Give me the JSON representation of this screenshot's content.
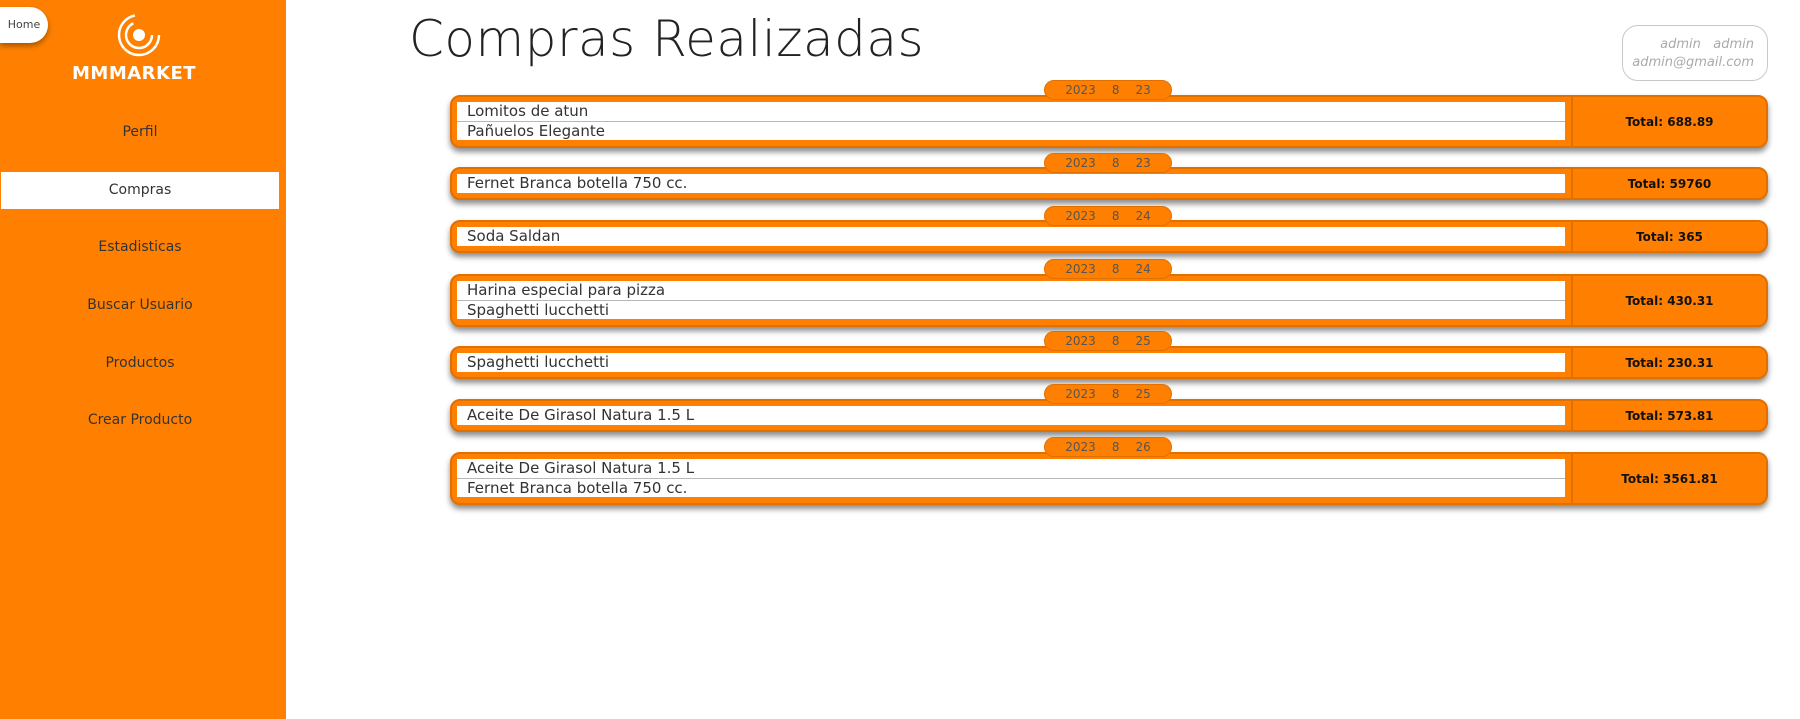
{
  "home": {
    "label": "Home"
  },
  "brand": {
    "logo_text": "MMMARKET"
  },
  "sidebar": {
    "items": [
      {
        "label": "Perfil"
      },
      {
        "label": "Compras"
      },
      {
        "label": "Estadisticas"
      },
      {
        "label": "Buscar Usuario"
      },
      {
        "label": "Productos"
      },
      {
        "label": "Crear Producto"
      }
    ],
    "active": "Compras"
  },
  "page": {
    "title": "Compras Realizadas"
  },
  "user": {
    "first_name": "admin",
    "last_name": "admin",
    "email": "admin@gmail.com"
  },
  "purchases": [
    {
      "year": "2023",
      "month": "8",
      "day": "23",
      "items": [
        "Lomitos de atun",
        "Pañuelos Elegante"
      ],
      "total": "Total: 688.89"
    },
    {
      "year": "2023",
      "month": "8",
      "day": "23",
      "items": [
        "Fernet Branca botella 750 cc."
      ],
      "total": "Total: 59760"
    },
    {
      "year": "2023",
      "month": "8",
      "day": "24",
      "items": [
        "Soda Saldan"
      ],
      "total": "Total: 365"
    },
    {
      "year": "2023",
      "month": "8",
      "day": "24",
      "items": [
        "Harina especial para pizza",
        "Spaghetti lucchetti"
      ],
      "total": "Total: 430.31"
    },
    {
      "year": "2023",
      "month": "8",
      "day": "25",
      "items": [
        "Spaghetti lucchetti"
      ],
      "total": "Total: 230.31"
    },
    {
      "year": "2023",
      "month": "8",
      "day": "25",
      "items": [
        "Aceite De Girasol Natura 1.5 L"
      ],
      "total": "Total: 573.81"
    },
    {
      "year": "2023",
      "month": "8",
      "day": "26",
      "items": [
        "Aceite De Girasol Natura 1.5 L",
        "Fernet Branca botella 750 cc."
      ],
      "total": "Total: 3561.81"
    }
  ],
  "colors": {
    "accent": "#ff8000",
    "accent_border": "#e07000"
  }
}
